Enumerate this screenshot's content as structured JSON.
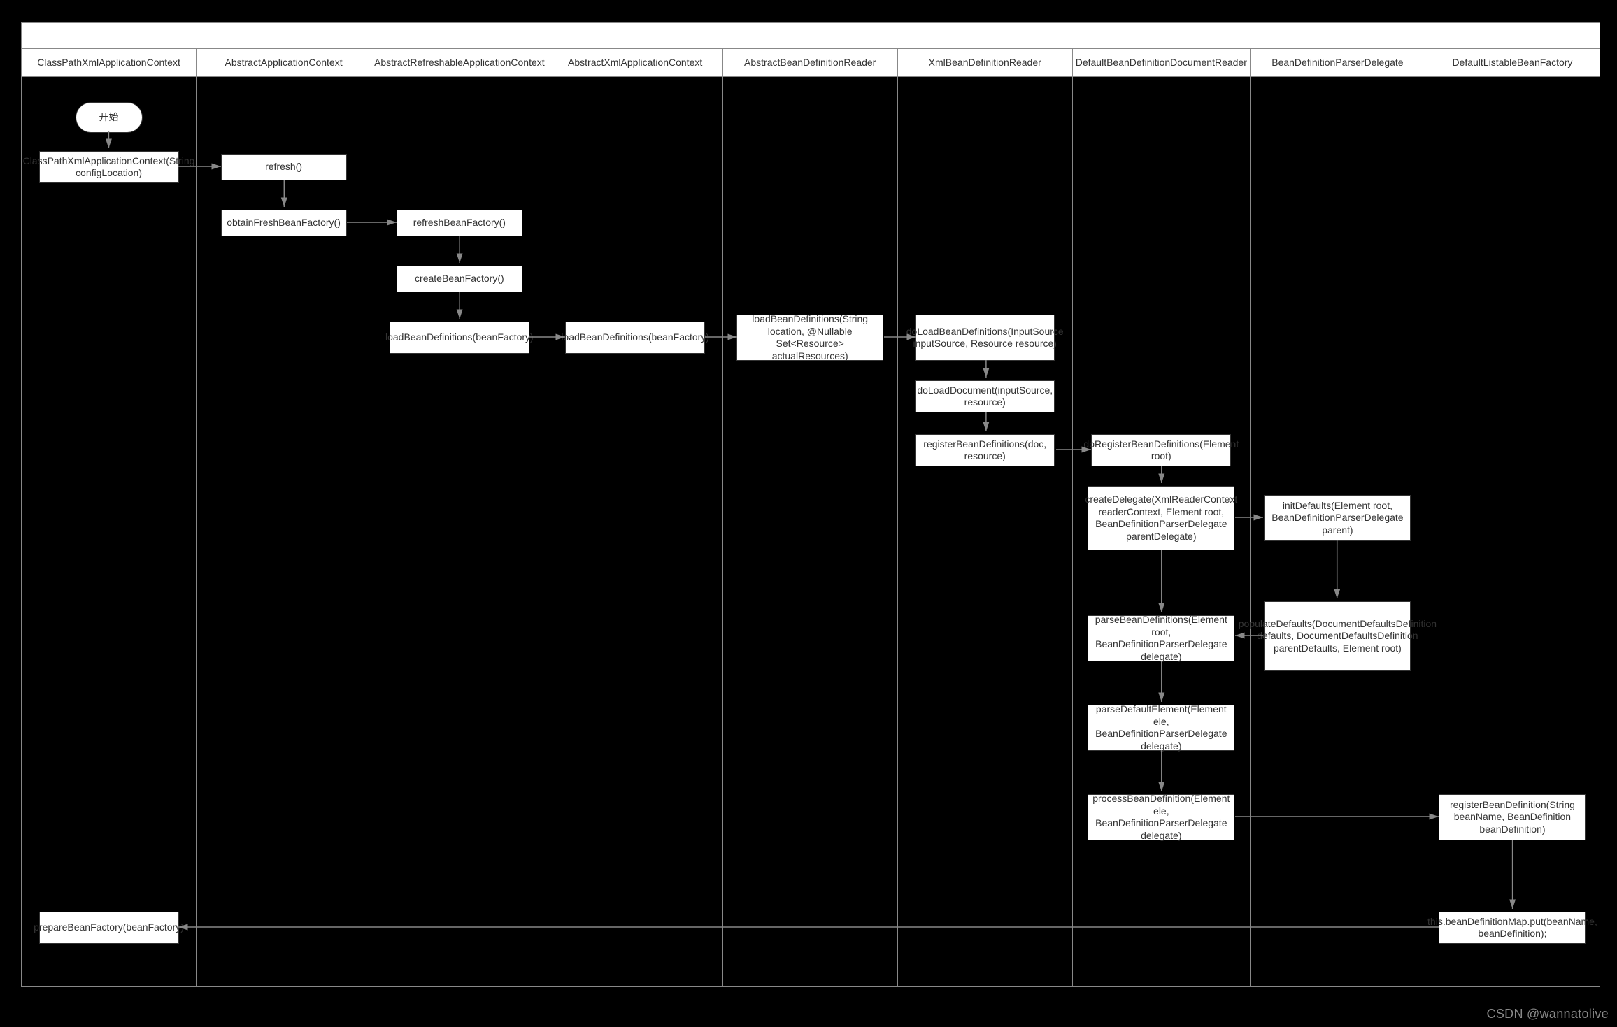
{
  "watermark": "CSDN @wannatolive",
  "lanes": [
    {
      "header": "ClassPathXmlApplicationContext"
    },
    {
      "header": "AbstractApplicationContext"
    },
    {
      "header": "AbstractRefreshableApplicationContext"
    },
    {
      "header": "AbstractXmlApplicationContext"
    },
    {
      "header": "AbstractBeanDefinitionReader"
    },
    {
      "header": "XmlBeanDefinitionReader"
    },
    {
      "header": "DefaultBeanDefinitionDocumentReader"
    },
    {
      "header": "BeanDefinitionParserDelegate"
    },
    {
      "header": "DefaultListableBeanFactory"
    }
  ],
  "nodes": {
    "start": "开始",
    "c1a": "ClassPathXmlApplicationContext(String configLocation)",
    "c1b": "prepareBeanFactory(beanFactory)",
    "c2a": "refresh()",
    "c2b": "obtainFreshBeanFactory()",
    "c3a": "refreshBeanFactory()",
    "c3b": "createBeanFactory()",
    "c3c": "loadBeanDefinitions(beanFactory)",
    "c4a": "loadBeanDefinitions(beanFactory)",
    "c5a": "loadBeanDefinitions(String location, @Nullable Set<Resource> actualResources)",
    "c6a": "doLoadBeanDefinitions(InputSource inputSource, Resource resource)",
    "c6b": "doLoadDocument(inputSource, resource)",
    "c6c": "registerBeanDefinitions(doc, resource)",
    "c7a": "doRegisterBeanDefinitions(Element root)",
    "c7b": "createDelegate(XmlReaderContext readerContext, Element root, BeanDefinitionParserDelegate parentDelegate)",
    "c7c": "parseBeanDefinitions(Element root, BeanDefinitionParserDelegate delegate)",
    "c7d": "parseDefaultElement(Element ele, BeanDefinitionParserDelegate delegate)",
    "c7e": "processBeanDefinition(Element ele, BeanDefinitionParserDelegate delegate)",
    "c8a": "initDefaults(Element root, BeanDefinitionParserDelegate parent)",
    "c8b": "populateDefaults(DocumentDefaultsDefinition defaults, DocumentDefaultsDefinition parentDefaults, Element root)",
    "c9a": "registerBeanDefinition(String beanName, BeanDefinition beanDefinition)",
    "c9b": "this.beanDefinitionMap.put(beanName, beanDefinition);"
  }
}
